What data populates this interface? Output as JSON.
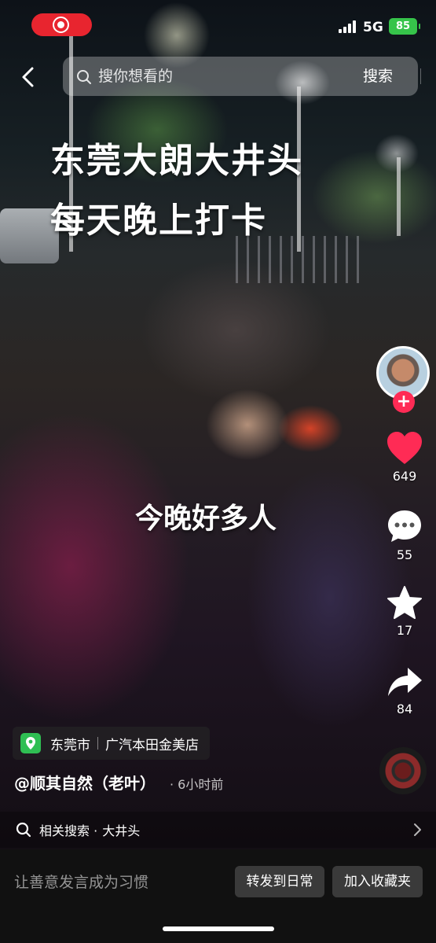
{
  "status_bar": {
    "network": "5G",
    "battery": "85"
  },
  "search": {
    "placeholder": "搜你想看的",
    "submit_label": "搜索"
  },
  "captions": {
    "title_line1": "东莞大朗大井头",
    "title_line2": "每天晚上打卡",
    "middle": "今晚好多人"
  },
  "actions": {
    "likes": "649",
    "comments": "55",
    "favorites": "17",
    "shares": "84"
  },
  "location": {
    "city": "东莞市",
    "place": "广汽本田金美店"
  },
  "post": {
    "author": "@顺其自然（老叶）",
    "time": "· 6小时前"
  },
  "related": {
    "label": "相关搜索 ·",
    "term": "大井头"
  },
  "comment_bar": {
    "placeholder": "让善意发言成为习惯",
    "repost_label": "转发到日常",
    "collect_label": "加入收藏夹"
  },
  "colors": {
    "like": "#ff2b55",
    "record": "#e8252f",
    "battery": "#36c44a",
    "location_pin": "#2fbf53"
  }
}
